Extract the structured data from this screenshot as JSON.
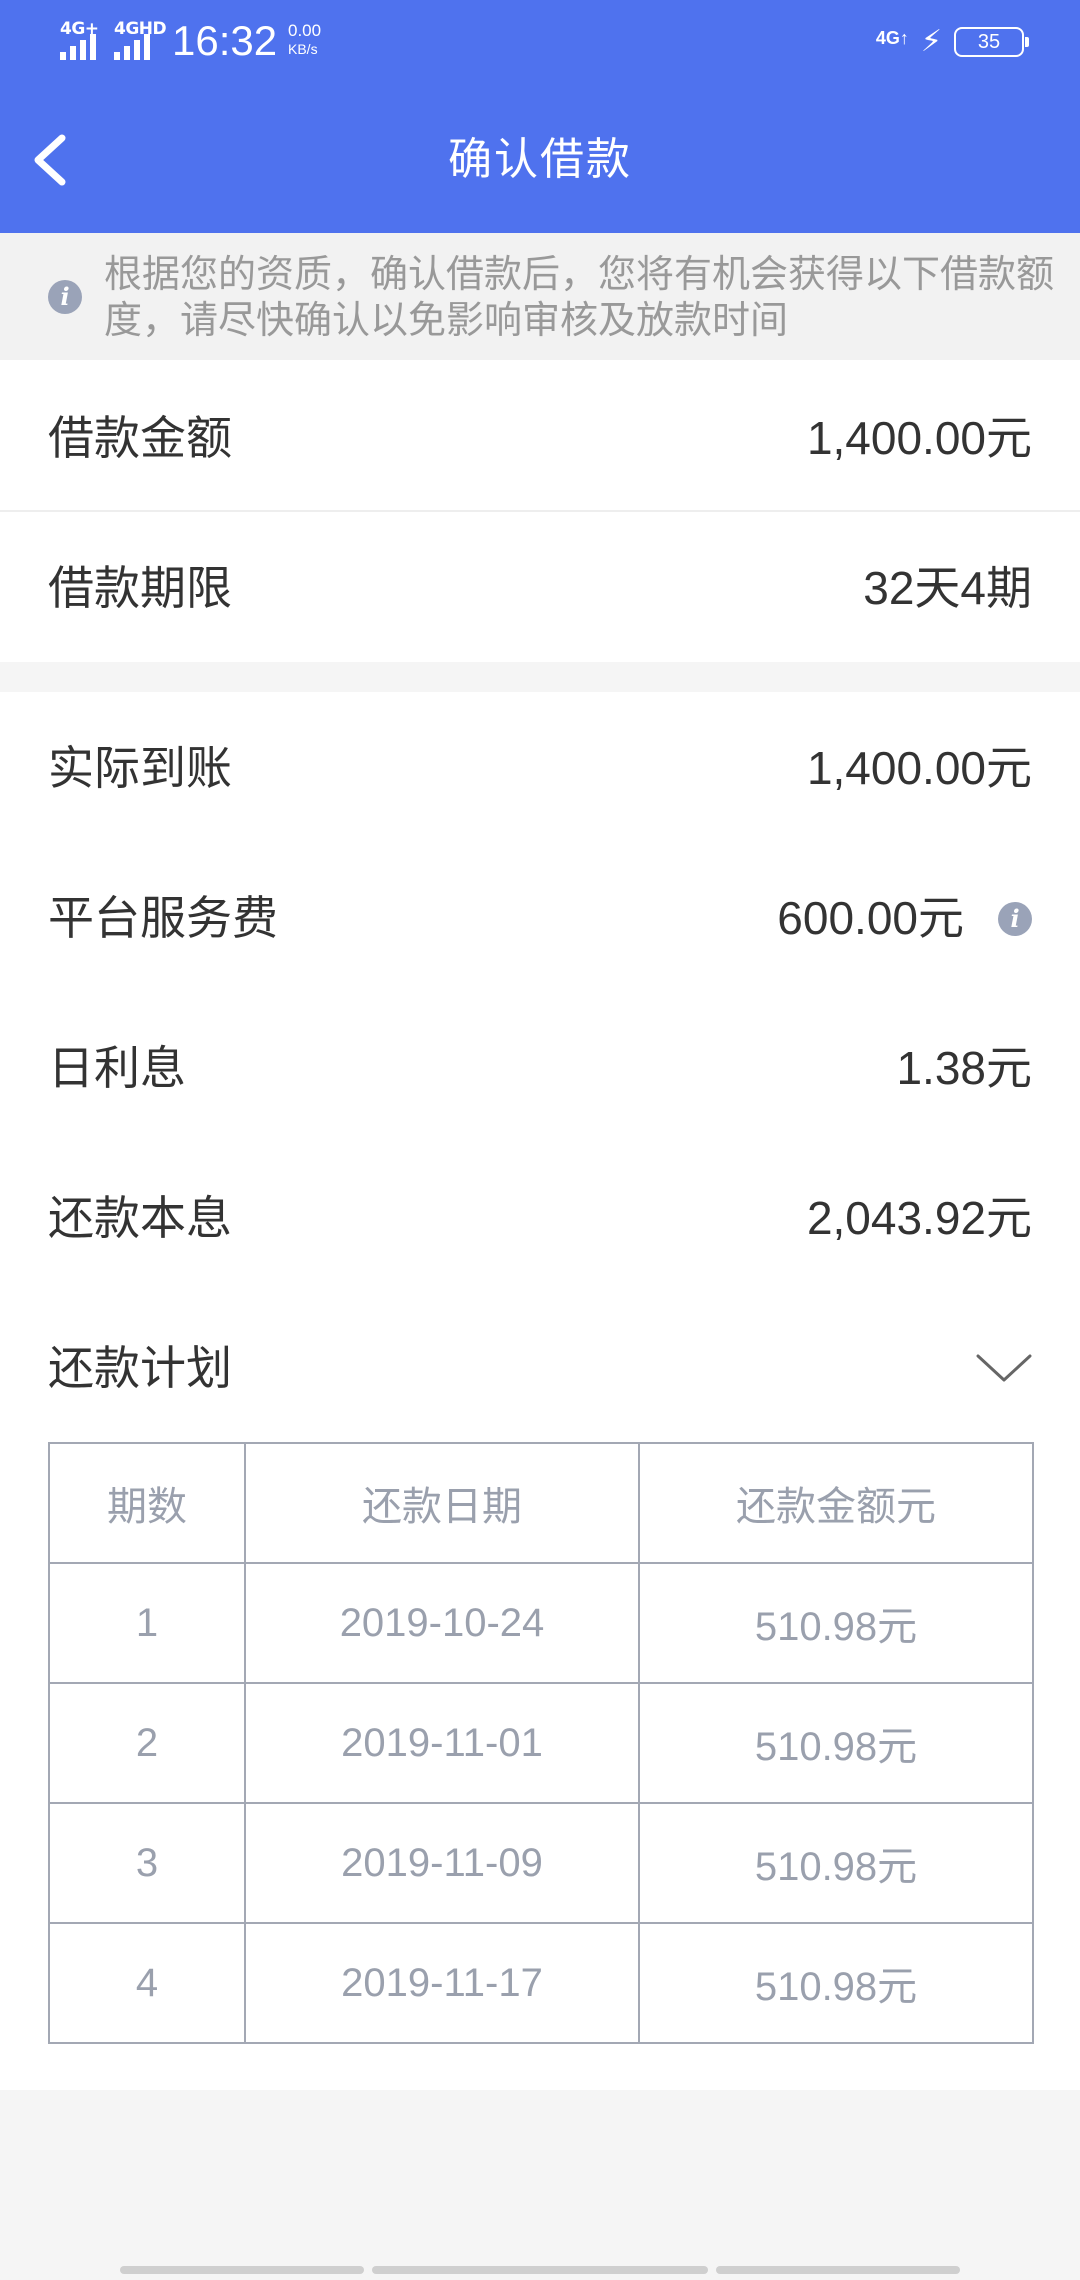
{
  "status_bar": {
    "signal1": "4G+",
    "signal2": "4GHD",
    "time": "16:32",
    "speed_value": "0.00",
    "speed_unit": "KB/s",
    "network": "4G↑",
    "battery_level": "35"
  },
  "header": {
    "title": "确认借款",
    "back_icon": "chevron-left-icon",
    "background_color": "#4f72ee"
  },
  "notice": {
    "icon": "info-icon",
    "text": "根据您的资质，确认借款后，您将有机会获得以下借款额度，请尽快确认以免影响审核及放款时间"
  },
  "loan": {
    "amount_label": "借款金额",
    "amount_value": "1,400.00元",
    "term_label": "借款期限",
    "term_value": "32天4期"
  },
  "details": {
    "received_label": "实际到账",
    "received_value": "1,400.00元",
    "fee_label": "平台服务费",
    "fee_value": "600.00元",
    "daily_interest_label": "日利息",
    "daily_interest_value": "1.38元",
    "total_label": "还款本息",
    "total_value": "2,043.92元",
    "plan_label": "还款计划",
    "plan_toggle_icon": "chevron-down-icon"
  },
  "plan_table": {
    "headers": [
      "期数",
      "还款日期",
      "还款金额元"
    ],
    "rows": [
      [
        "1",
        "2019-10-24",
        "510.98元"
      ],
      [
        "2",
        "2019-11-01",
        "510.98元"
      ],
      [
        "3",
        "2019-11-09",
        "510.98元"
      ],
      [
        "4",
        "2019-11-17",
        "510.98元"
      ]
    ]
  }
}
